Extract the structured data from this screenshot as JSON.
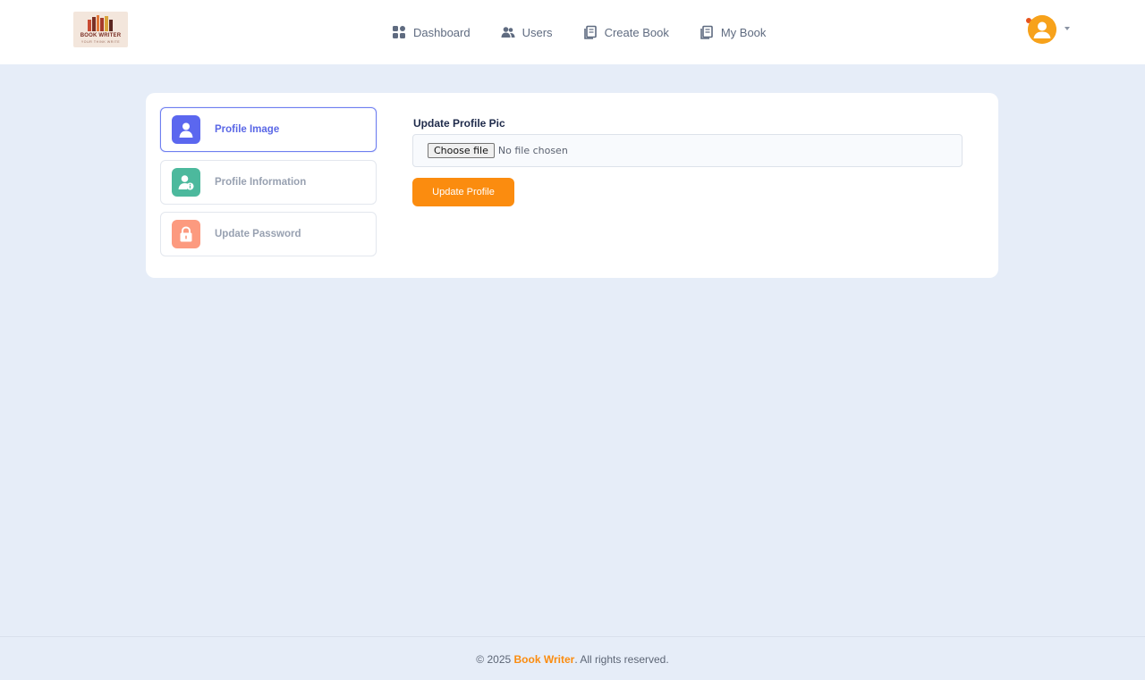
{
  "header": {
    "logo": {
      "title": "BOOK WRITER",
      "tagline": "YOUR THINK WRITE"
    },
    "nav": [
      {
        "label": "Dashboard",
        "icon": "dashboard-grid-icon"
      },
      {
        "label": "Users",
        "icon": "users-icon"
      },
      {
        "label": "Create Book",
        "icon": "book-icon"
      },
      {
        "label": "My Book",
        "icon": "book-icon"
      }
    ],
    "user_menu": {
      "icon": "user-avatar-icon"
    }
  },
  "sidebar": {
    "items": [
      {
        "label": "Profile Image",
        "icon": "user-icon",
        "color": "#5b67ef",
        "active": true
      },
      {
        "label": "Profile Information",
        "icon": "user-info-icon",
        "color": "#4cb99d",
        "active": false
      },
      {
        "label": "Update Password",
        "icon": "lock-icon",
        "color": "#fc9a7f",
        "active": false
      }
    ]
  },
  "form": {
    "label": "Update Profile Pic",
    "file_button": "Choose file",
    "file_status": "No file chosen",
    "submit_label": "Update Profile"
  },
  "footer": {
    "prefix": "© 2025 ",
    "brand": "Book Writer",
    "suffix": ". All rights reserved."
  },
  "colors": {
    "accent": "#fb8c0f",
    "background": "#e6edf8",
    "active_item": "#5a67e6"
  }
}
